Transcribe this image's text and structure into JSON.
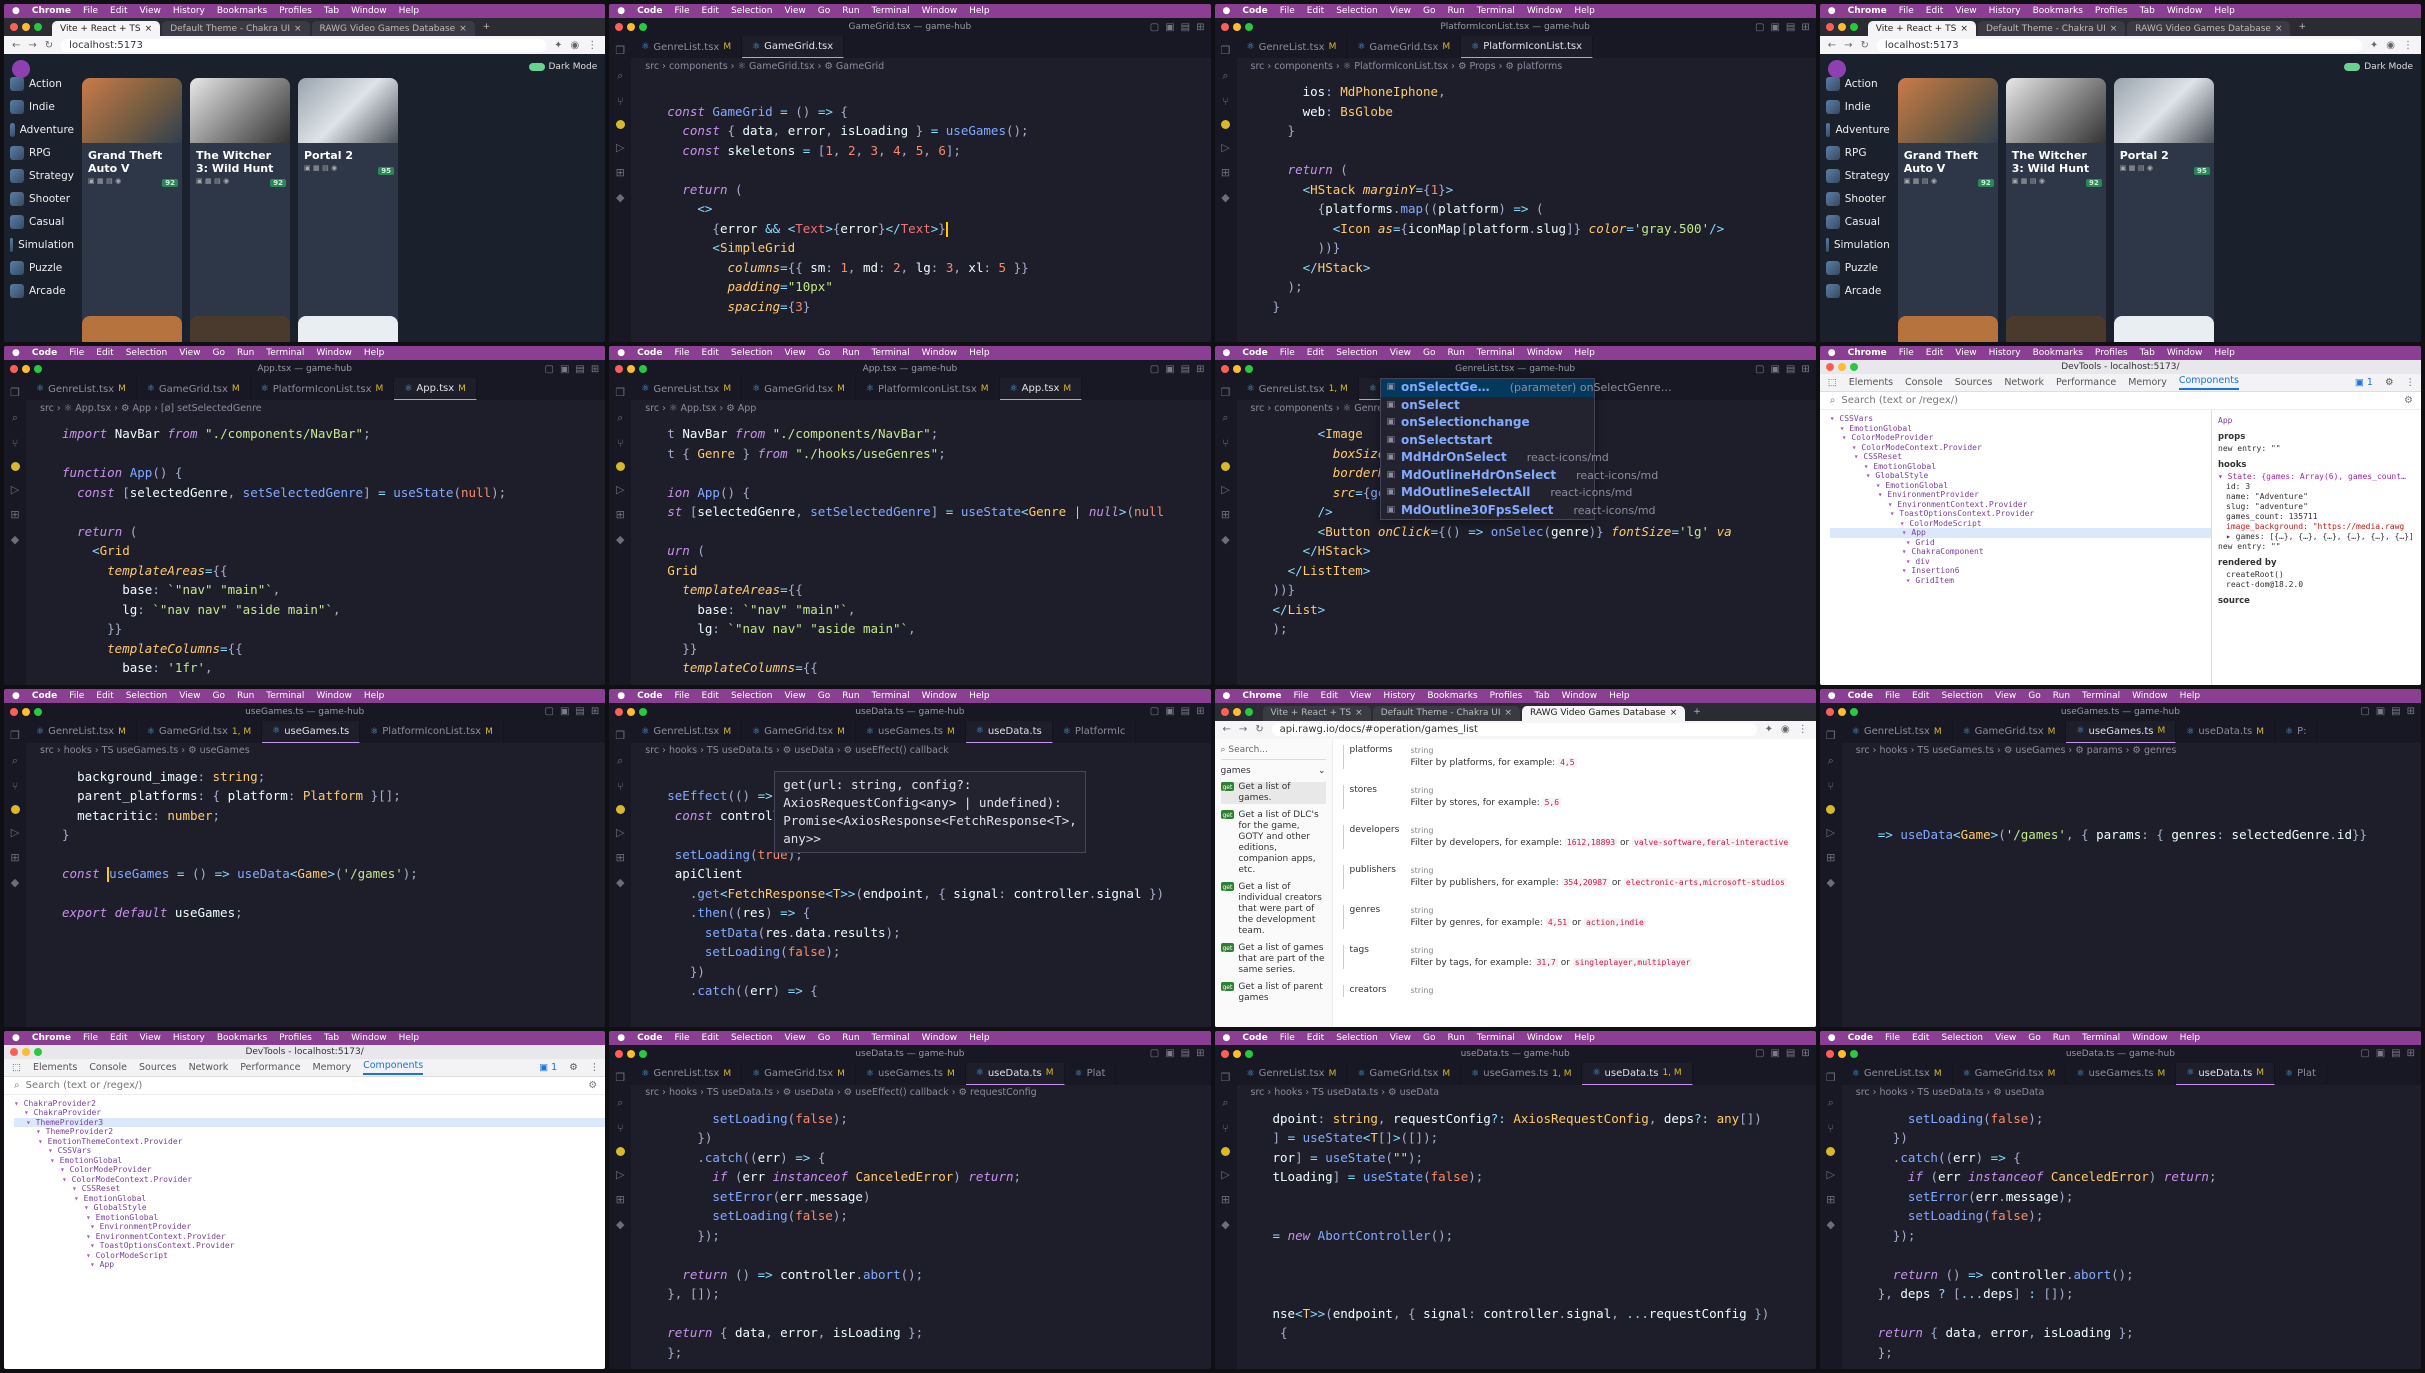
{
  "menubar": {
    "code": [
      "Code",
      "File",
      "Edit",
      "Selection",
      "View",
      "Go",
      "Run",
      "Terminal",
      "Window",
      "Help"
    ],
    "chrome": [
      "Chrome",
      "File",
      "Edit",
      "View",
      "History",
      "Bookmarks",
      "Profiles",
      "Tab",
      "Window",
      "Help"
    ]
  },
  "chrome": {
    "tabs": [
      "Vite + React + TS",
      "Default Theme - Chakra UI",
      "RAWG Video Games Database"
    ],
    "url": "localhost:5173",
    "docs_url": "api.rawg.io/docs/#operation/games_list"
  },
  "gamehub": {
    "dark_mode": "Dark Mode",
    "genres": [
      "Action",
      "Indie",
      "Adventure",
      "RPG",
      "Strategy",
      "Shooter",
      "Casual",
      "Simulation",
      "Puzzle",
      "Arcade"
    ],
    "cards": [
      {
        "name": "Grand Theft Auto V",
        "score": "92"
      },
      {
        "name": "The Witcher 3: Wild Hunt",
        "score": "92"
      },
      {
        "name": "Portal 2",
        "score": "95"
      }
    ]
  },
  "panels": {
    "p2": {
      "title": "GameGrid.tsx — game-hub",
      "tabs": [
        {
          "label": "GenreList.tsx",
          "m": "M"
        },
        {
          "label": "GameGrid.tsx",
          "m": ""
        }
      ],
      "crumbs": "src › components › ⚛ GameGrid.tsx › ⚙ GameGrid"
    },
    "p3": {
      "title": "PlatformIconList.tsx — game-hub",
      "tabs": [
        {
          "label": "GenreList.tsx",
          "m": "M"
        },
        {
          "label": "GameGrid.tsx",
          "m": "M"
        },
        {
          "label": "PlatformIconList.tsx",
          "m": ""
        }
      ],
      "crumbs": "src › components › ⚛ PlatformIconList.tsx › ⚙ Props › ⚙ platforms"
    },
    "p5": {
      "title": "App.tsx — game-hub",
      "tabs": [
        {
          "label": "GenreList.tsx",
          "m": "M"
        },
        {
          "label": "GameGrid.tsx",
          "m": "M"
        },
        {
          "label": "PlatformIconList.tsx",
          "m": "M"
        },
        {
          "label": "App.tsx",
          "m": "M"
        }
      ],
      "crumbs": "src › ⚛ App.tsx › ⚙ App › [ø] setSelectedGenre"
    },
    "p6": {
      "title": "App.tsx — game-hub",
      "tabs": [
        {
          "label": "GenreList.tsx",
          "m": "M"
        },
        {
          "label": "GameGrid.tsx",
          "m": "M"
        },
        {
          "label": "PlatformIconList.tsx",
          "m": "M"
        },
        {
          "label": "App.tsx",
          "m": "M"
        }
      ],
      "crumbs": "src › ⚛ App.tsx › ⚙ App"
    },
    "p7": {
      "title": "GenreList.tsx — game-hub",
      "tabs": [
        {
          "label": "GenreList.tsx",
          "m": "1, M"
        },
        {
          "label": "GameGrid.tsx",
          "m": "M"
        }
      ],
      "crumbs": "src › components › ⚛ GenreList.tsx › ⚙ Ge",
      "suggest": [
        {
          "label": "onSelectGe…",
          "src": "(parameter) onSelectGenre…"
        },
        {
          "label": "onSelect",
          "src": ""
        },
        {
          "label": "onSelectionchange",
          "src": ""
        },
        {
          "label": "onSelectstart",
          "src": ""
        },
        {
          "label": "MdHdrOnSelect",
          "src": "react-icons/md"
        },
        {
          "label": "MdOutlineHdrOnSelect",
          "src": "react-icons/md"
        },
        {
          "label": "MdOutlineSelectAll",
          "src": "react-icons/md"
        },
        {
          "label": "MdOutline30FpsSelect",
          "src": "react-icons/md"
        }
      ]
    },
    "p9": {
      "title": "useGames.ts — game-hub",
      "tabs": [
        {
          "label": "GenreList.tsx",
          "m": "M"
        },
        {
          "label": "GameGrid.tsx",
          "m": "1, M"
        },
        {
          "label": "useGames.ts",
          "m": ""
        },
        {
          "label": "PlatformIconList.tsx",
          "m": "M"
        }
      ],
      "crumbs": "src › hooks › TS useGames.ts › ⚙ useGames"
    },
    "p10": {
      "title": "useData.ts — game-hub",
      "tabs": [
        {
          "label": "GenreList.tsx",
          "m": "M"
        },
        {
          "label": "GameGrid.tsx",
          "m": "M"
        },
        {
          "label": "useGames.ts",
          "m": "M"
        },
        {
          "label": "useData.ts",
          "m": ""
        },
        {
          "label": "PlatformIc",
          "m": ""
        }
      ],
      "crumbs": "src › hooks › TS useData.ts › ⚙ useData › ⚙ useEffect() callback",
      "hover": "get(url: string, config?:\nAxiosRequestConfig<any> | undefined):\nPromise<AxiosResponse<FetchResponse<T>,\nany>>"
    },
    "p12": {
      "title": "useGames.ts — game-hub",
      "tabs": [
        {
          "label": "GenreList.tsx",
          "m": "M"
        },
        {
          "label": "GameGrid.tsx",
          "m": "M"
        },
        {
          "label": "useGames.ts",
          "m": "M"
        },
        {
          "label": "useData.ts",
          "m": "M"
        },
        {
          "label": "P:",
          "m": ""
        }
      ],
      "crumbs": "src › hooks › TS useGames.ts › ⚙ useGames › ⚙ params › ⚙ genres"
    },
    "p14": {
      "title": "useData.ts — game-hub",
      "tabs": [
        {
          "label": "GenreList.tsx",
          "m": "M"
        },
        {
          "label": "GameGrid.tsx",
          "m": "M"
        },
        {
          "label": "useGames.ts",
          "m": "M"
        },
        {
          "label": "useData.ts",
          "m": "M"
        },
        {
          "label": "Plat",
          "m": ""
        }
      ],
      "crumbs": "src › hooks › TS useData.ts › ⚙ useData › ⚙ useEffect() callback › ⚙ requestConfig"
    },
    "p15": {
      "title": "useData.ts — game-hub",
      "tabs": [
        {
          "label": "GenreList.tsx",
          "m": "M"
        },
        {
          "label": "GameGrid.tsx",
          "m": "M"
        },
        {
          "label": "useGames.ts",
          "m": "1, M"
        },
        {
          "label": "useData.ts",
          "m": "1, M"
        }
      ],
      "crumbs": "src › hooks › TS useData.ts › ⚙ useData"
    },
    "p16": {
      "title": "useData.ts — game-hub",
      "tabs": [
        {
          "label": "GenreList.tsx",
          "m": "M"
        },
        {
          "label": "GameGrid.tsx",
          "m": "M"
        },
        {
          "label": "useGames.ts",
          "m": "M"
        },
        {
          "label": "useData.ts",
          "m": "M"
        },
        {
          "label": "Plat",
          "m": ""
        }
      ],
      "crumbs": "src › hooks › TS useData.ts › ⚙ useData"
    }
  },
  "devtools": {
    "title": "DevTools - localhost:5173/",
    "tabs": [
      "Elements",
      "Console",
      "Sources",
      "Network",
      "Performance",
      "Memory",
      "Components"
    ],
    "search_placeholder": "Search (text or /regex/)",
    "issues": "1",
    "tree_a": [
      "CSSVars",
      "EmotionGlobal",
      "ColorModeProvider",
      "ColorModeContext.Provider",
      "CSSReset",
      "EmotionGlobal",
      "GlobalStyle",
      "EmotionGlobal",
      "EnvironmentProvider",
      "EnvironmentContext.Provider",
      "ToastOptionsContext.Provider",
      "ColorModeScript",
      "App",
      "Grid",
      "ChakraComponent",
      "div",
      "Insertion6",
      "GridItem"
    ],
    "tree_b": [
      "ChakraProvider2",
      "ChakraProvider",
      "ThemeProvider3",
      "ThemeProvider2",
      "EmotionThemeContext.Provider",
      "CSSVars",
      "EmotionGlobal",
      "ColorModeProvider",
      "ColorModeContext.Provider",
      "CSSReset",
      "EmotionGlobal",
      "GlobalStyle",
      "EmotionGlobal",
      "EnvironmentProvider",
      "EnvironmentContext.Provider",
      "ToastOptionsContext.Provider",
      "ColorModeScript",
      "App"
    ],
    "side": {
      "selected": "App",
      "props_h": "props",
      "props_new": "new entry: \"\"",
      "hooks_h": "hooks",
      "state": "State: {games: Array(6), games_count…",
      "id": "id: 3",
      "name": "name: \"Adventure\"",
      "slug": "slug: \"adventure\"",
      "games_count": "games_count: 135711",
      "image_bg": "image_background: \"https://media.rawg",
      "games": "games: [{…}, {…}, {…}, {…}, {…}, {…}]",
      "hook_new": "new entry: \"\"",
      "rendered_h": "rendered by",
      "r1": "createRoot()",
      "r2": "react-dom@18.2.0",
      "source_h": "source"
    }
  },
  "docs": {
    "search": "Search...",
    "section": "games",
    "items": [
      "Get a list of games.",
      "Get a list of DLC's for the game, GOTY and other editions, companion apps, etc.",
      "Get a list of individual creators that were part of the development team.",
      "Get a list of games that are part of the same series.",
      "Get a list of parent games"
    ],
    "params": [
      {
        "name": "platforms",
        "desc": "Filter by platforms, for example:",
        "ex": "4,5"
      },
      {
        "name": "stores",
        "desc": "Filter by stores, for example:",
        "ex": "5,6"
      },
      {
        "name": "developers",
        "desc": "Filter by developers, for example:",
        "ex": "1612,18893",
        "or": "valve-software,feral-interactive"
      },
      {
        "name": "publishers",
        "desc": "Filter by publishers, for example:",
        "ex": "354,20987",
        "or": "electronic-arts,microsoft-studios"
      },
      {
        "name": "genres",
        "desc": "Filter by genres, for example:",
        "ex": "4,51",
        "or": "action,indie"
      },
      {
        "name": "tags",
        "desc": "Filter by tags, for example:",
        "ex": "31,7",
        "or": "singleplayer,multiplayer"
      },
      {
        "name": "creators",
        "desc": "",
        "ex": ""
      }
    ],
    "type": "string",
    "or_word": "or"
  }
}
